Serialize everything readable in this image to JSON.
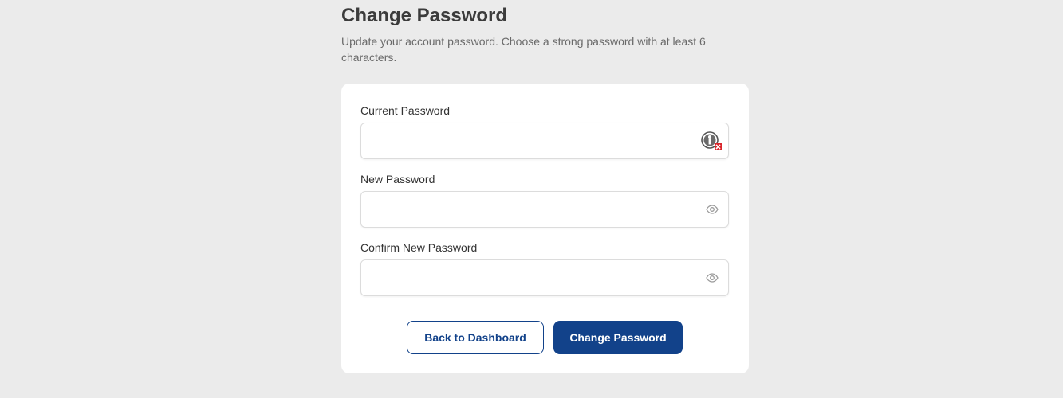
{
  "header": {
    "title": "Change Password",
    "description": "Update your account password. Choose a strong password with at least 6 characters."
  },
  "form": {
    "current_password": {
      "label": "Current Password",
      "value": "",
      "icon": "password-manager-icon"
    },
    "new_password": {
      "label": "New Password",
      "value": "",
      "icon": "eye-icon"
    },
    "confirm_password": {
      "label": "Confirm New Password",
      "value": "",
      "icon": "eye-icon"
    }
  },
  "actions": {
    "back_label": "Back to Dashboard",
    "submit_label": "Change Password"
  },
  "colors": {
    "primary": "#12428a",
    "background": "#ebebeb",
    "card": "#ffffff",
    "pm_badge": "#d9262c"
  }
}
